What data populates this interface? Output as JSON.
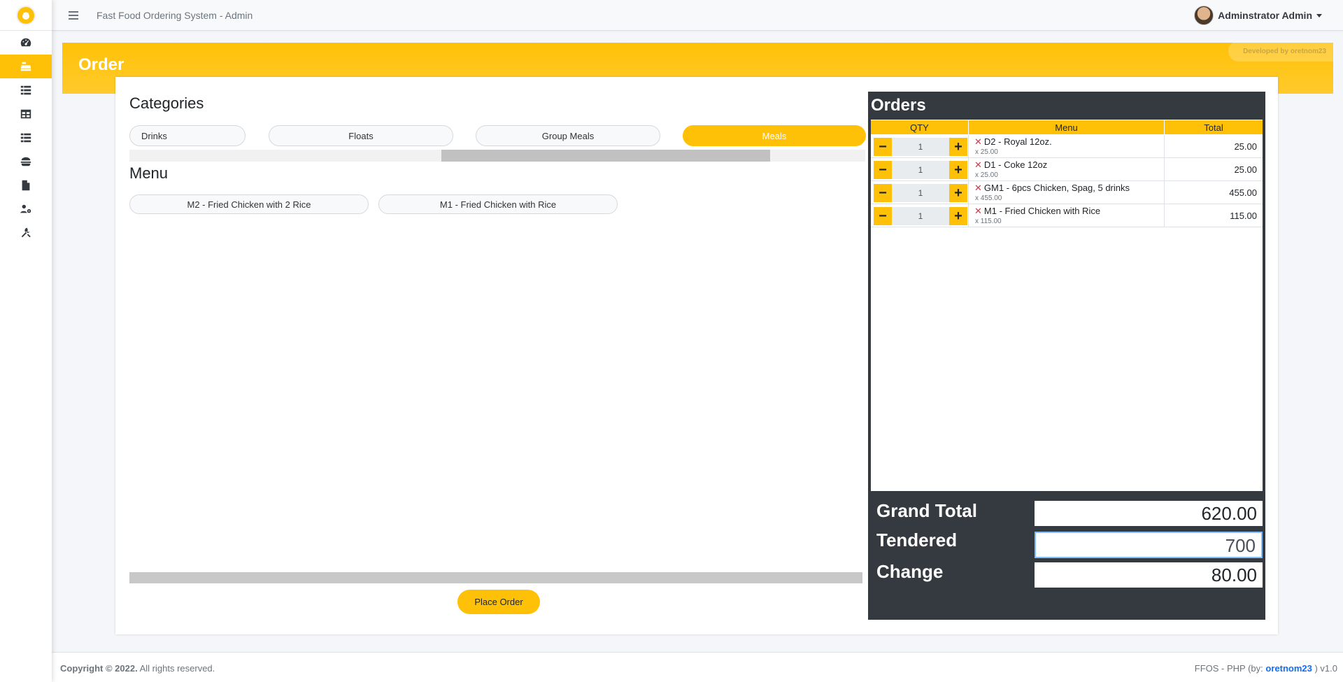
{
  "topbar": {
    "title": "Fast Food Ordering System - Admin",
    "user": "Adminstrator Admin"
  },
  "sidebar": {
    "items": [
      {
        "icon": "dashboard-icon"
      },
      {
        "icon": "cash-register-icon",
        "active": true
      },
      {
        "icon": "list-icon"
      },
      {
        "icon": "table-icon"
      },
      {
        "icon": "list-alt-icon"
      },
      {
        "icon": "burger-icon"
      },
      {
        "icon": "file-icon"
      },
      {
        "icon": "users-cog-icon"
      },
      {
        "icon": "tools-icon"
      }
    ]
  },
  "header": {
    "title": "Order",
    "dev_badge": "Developed by oretnom23"
  },
  "categories": {
    "title": "Categories",
    "items": [
      {
        "label": "Drinks"
      },
      {
        "label": "Floats"
      },
      {
        "label": "Group Meals"
      },
      {
        "label": "Meals",
        "active": true
      }
    ]
  },
  "menu": {
    "title": "Menu",
    "items": [
      {
        "label": "M2 - Fried Chicken with 2 Rice"
      },
      {
        "label": "M1 - Fried Chicken with Rice"
      }
    ]
  },
  "place_order_label": "Place Order",
  "orders": {
    "title": "Orders",
    "headers": {
      "qty": "QTY",
      "menu": "Menu",
      "total": "Total"
    },
    "rows": [
      {
        "qty": "1",
        "name": "D2 - Royal 12oz.",
        "price": "x 25.00",
        "total": "25.00"
      },
      {
        "qty": "1",
        "name": "D1 - Coke 12oz",
        "price": "x 25.00",
        "total": "25.00"
      },
      {
        "qty": "1",
        "name": "GM1 - 6pcs Chicken, Spag, 5 drinks",
        "price": "x 455.00",
        "total": "455.00"
      },
      {
        "qty": "1",
        "name": "M1 - Fried Chicken with Rice",
        "price": "x 115.00",
        "total": "115.00"
      }
    ],
    "minus": "−",
    "plus": "+",
    "remove": "✕"
  },
  "summary": {
    "grand_total_label": "Grand Total",
    "grand_total": "620.00",
    "tendered_label": "Tendered",
    "tendered": "700",
    "change_label": "Change",
    "change": "80.00"
  },
  "footer": {
    "copyright": "Copyright © 2022.",
    "rights": "All rights reserved.",
    "credit_prefix": "FFOS - PHP (by:",
    "credit_author": "oretnom23",
    "credit_suffix": ") v1.0"
  },
  "colors": {
    "accent": "#ffc107",
    "panel": "#343a40",
    "danger": "#dc3545",
    "link": "#0d6efd"
  }
}
